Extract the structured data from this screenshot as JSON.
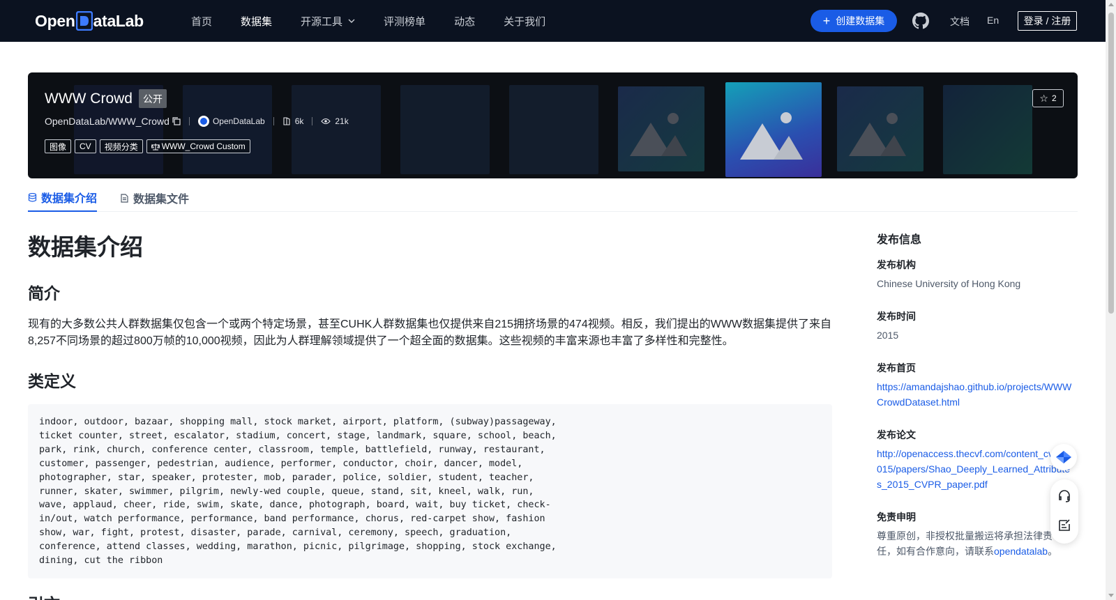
{
  "nav": {
    "logo_text_a": "Open",
    "logo_text_b": "ataLab",
    "links": [
      "首页",
      "数据集",
      "开源工具",
      "评测榜单",
      "动态",
      "关于我们"
    ],
    "create_button": "创建数据集",
    "docs": "文档",
    "lang": "En",
    "login": "登录 / 注册"
  },
  "banner": {
    "title": "WWW Crowd",
    "visibility": "公开",
    "repo": "OpenDataLab/WWW_Crowd",
    "org": "OpenDataLab",
    "downloads": "6k",
    "views": "21k",
    "tags": [
      "图像",
      "CV",
      "视频分类"
    ],
    "license": "WWW_Crowd Custom",
    "stars": "2"
  },
  "tabs": [
    "数据集介绍",
    "数据集文件"
  ],
  "content": {
    "heading": "数据集介绍",
    "section_intro": "简介",
    "intro_text": "现有的大多数公共人群数据集仅包含一个或两个特定场景，甚至CUHK人群数据集也仅提供来自215拥挤场景的474视频。相反，我们提出的WWW数据集提供了来自8,257不同场景的超过800万帧的10,000视频，因此为人群理解领域提供了一个超全面的数据集。这些视频的丰富来源也丰富了多样性和完整性。",
    "section_classes": "类定义",
    "classes_text": "indoor, outdoor, bazaar, shopping mall, stock market, airport, platform, (subway)passageway,\nticket counter, street, escalator, stadium, concert, stage, landmark, square, school, beach,\npark, rink, church, conference center, classroom, temple, battlefield, runway, restaurant,\ncustomer, passenger, pedestrian, audience, performer, conductor, choir, dancer, model,\nphotographer, star, speaker, protester, mob, parader, police, soldier, student, teacher,\nrunner, skater, swimmer, pilgrim, newly-wed couple, queue, stand, sit, kneel, walk, run,\nwave, applaud, cheer, ride, swim, skate, dance, photograph, board, wait, buy ticket, check-\nin/out, watch performance, performance, band performance, chorus, red-carpet show, fashion\nshow, war, fight, protest, disaster, parade, carnival, ceremony, speech, graduation,\nconference, attend classes, wedding, marathon, picnic, pilgrimage, shopping, stock exchange,\ndining, cut the ribbon",
    "section_cite": "引文"
  },
  "sidebar": {
    "title": "发布信息",
    "org_label": "发布机构",
    "org_value": "Chinese University of Hong Kong",
    "time_label": "发布时间",
    "time_value": "2015",
    "home_label": "发布首页",
    "home_value": "https://amandajshao.github.io/projects/WWWCrowdDataset.html",
    "paper_label": "发布论文",
    "paper_value": "http://openaccess.thecvf.com/content_cvpr_2015/papers/Shao_Deeply_Learned_Attributes_2015_CVPR_paper.pdf",
    "disclaimer_label": "免责申明",
    "disclaimer_text": "尊重原创，非授权批量搬运将承担法律责任，如有合作意向，请联系",
    "disclaimer_link": "opendatalab",
    "disclaimer_end": "。"
  },
  "colors": {
    "brand": "#1a5ce6",
    "nav_bg": "#0b1220",
    "banner_bg": "#0c0f14"
  }
}
